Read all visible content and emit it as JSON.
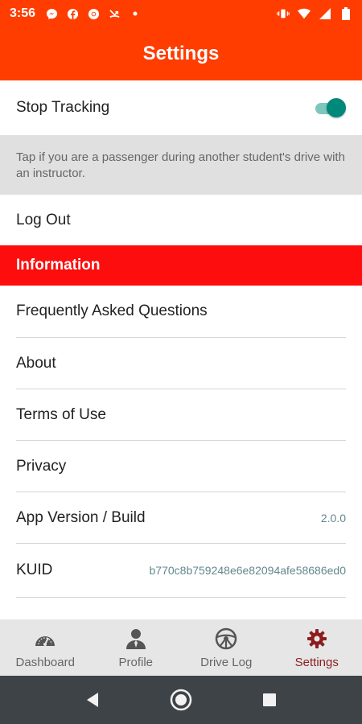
{
  "status_bar": {
    "time": "3:56",
    "left_icons": [
      "messenger-icon",
      "facebook-icon",
      "chrome-icon",
      "missed-call-icon",
      "dot-icon"
    ],
    "right_icons": [
      "vibrate-icon",
      "wifi-icon",
      "signal-icon",
      "battery-icon"
    ]
  },
  "header": {
    "title": "Settings"
  },
  "settings": {
    "stop_tracking": {
      "label": "Stop Tracking",
      "enabled": true
    },
    "helper_text": "Tap if you are a passenger during another student's drive with an instructor.",
    "logout_label": "Log Out"
  },
  "information": {
    "header": "Information",
    "items": [
      {
        "label": "Frequently Asked Questions",
        "value": ""
      },
      {
        "label": "About",
        "value": ""
      },
      {
        "label": "Terms of Use",
        "value": ""
      },
      {
        "label": "Privacy",
        "value": ""
      },
      {
        "label": "App Version / Build",
        "value": "2.0.0"
      },
      {
        "label": "KUID",
        "value": "b770c8b759248e6e82094afe58686ed0"
      }
    ]
  },
  "bottom_nav": {
    "items": [
      {
        "label": "Dashboard",
        "icon": "speedometer-icon",
        "active": false
      },
      {
        "label": "Profile",
        "icon": "person-icon",
        "active": false
      },
      {
        "label": "Drive Log",
        "icon": "steering-wheel-icon",
        "active": false
      },
      {
        "label": "Settings",
        "icon": "gear-icon",
        "active": true
      }
    ]
  },
  "colors": {
    "app_bar": "#ff3d00",
    "section_header": "#fd0d0d",
    "toggle_on": "#00897b",
    "nav_active": "#8d1d1d",
    "system_nav": "#3e4347"
  }
}
